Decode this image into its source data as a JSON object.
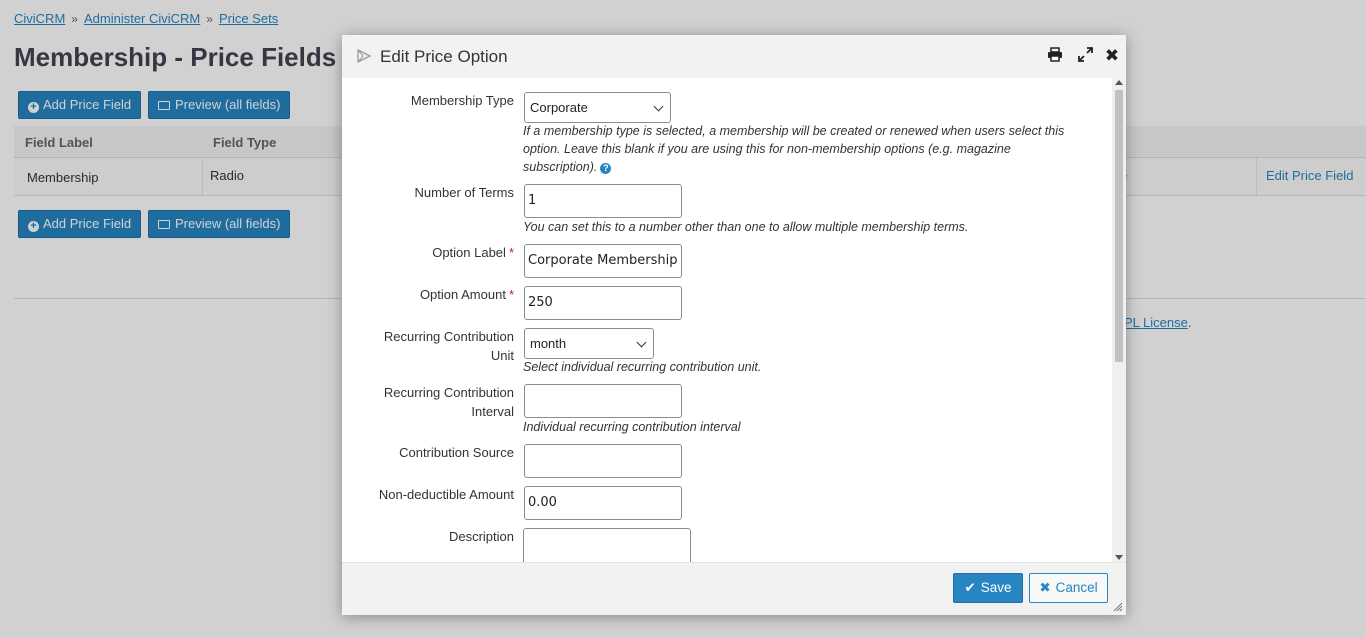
{
  "breadcrumb": {
    "items": [
      "CiviCRM",
      "Administer CiviCRM",
      "Price Sets"
    ],
    "separator": "»"
  },
  "page": {
    "title": "Membership - Price Fields",
    "add_button": "Add Price Field",
    "preview_button": "Preview (all fields)"
  },
  "table": {
    "headers": [
      "Field Label",
      "Field Type"
    ],
    "rows": [
      {
        "label": "Membership",
        "type": "Radio",
        "action": "Edit Price Field"
      }
    ],
    "partial_link": "e"
  },
  "footer": {
    "license_link": "PL License",
    "trailing": "."
  },
  "dialog": {
    "title": "Edit Price Option",
    "print_icon": "printer-icon",
    "maximize_icon": "expand-icon",
    "close_icon": "close-icon",
    "fields": {
      "membership_type": {
        "label": "Membership Type",
        "value": "Corporate",
        "help": "If a membership type is selected, a membership will be created or renewed when users select this option. Leave this blank if you are using this for non-membership options (e.g. magazine subscription)."
      },
      "num_terms": {
        "label": "Number of Terms",
        "value": "1",
        "help": "You can set this to a number other than one to allow multiple membership terms."
      },
      "option_label": {
        "label": "Option Label",
        "value": "Corporate Membership"
      },
      "option_amount": {
        "label": "Option Amount",
        "value": "250"
      },
      "recur_unit": {
        "label_line1": "Recurring Contribution",
        "label_line2": "Unit",
        "value": "month",
        "help": "Select individual recurring contribution unit."
      },
      "recur_interval": {
        "label_line1": "Recurring Contribution",
        "label_line2": "Interval",
        "value": "",
        "help": "Individual recurring contribution interval"
      },
      "contribution_source": {
        "label": "Contribution Source",
        "value": ""
      },
      "non_deductible": {
        "label": "Non-deductible Amount",
        "value": "0.00"
      },
      "description": {
        "label": "Description",
        "value": ""
      }
    },
    "required_marker": "*",
    "save_label": "Save",
    "cancel_label": "Cancel"
  },
  "colors": {
    "accent": "#2786c2",
    "required": "#c21d1d",
    "title": "#464354"
  }
}
